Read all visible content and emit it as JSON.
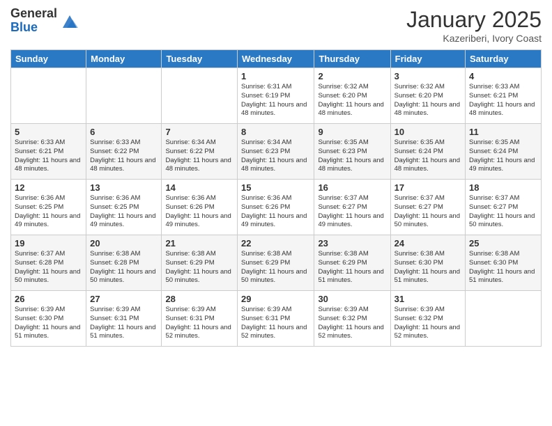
{
  "logo": {
    "general": "General",
    "blue": "Blue"
  },
  "header": {
    "month": "January 2025",
    "location": "Kazeriberi, Ivory Coast"
  },
  "weekdays": [
    "Sunday",
    "Monday",
    "Tuesday",
    "Wednesday",
    "Thursday",
    "Friday",
    "Saturday"
  ],
  "weeks": [
    [
      {
        "day": "",
        "sunrise": "",
        "sunset": "",
        "daylight": ""
      },
      {
        "day": "",
        "sunrise": "",
        "sunset": "",
        "daylight": ""
      },
      {
        "day": "",
        "sunrise": "",
        "sunset": "",
        "daylight": ""
      },
      {
        "day": "1",
        "sunrise": "Sunrise: 6:31 AM",
        "sunset": "Sunset: 6:19 PM",
        "daylight": "Daylight: 11 hours and 48 minutes."
      },
      {
        "day": "2",
        "sunrise": "Sunrise: 6:32 AM",
        "sunset": "Sunset: 6:20 PM",
        "daylight": "Daylight: 11 hours and 48 minutes."
      },
      {
        "day": "3",
        "sunrise": "Sunrise: 6:32 AM",
        "sunset": "Sunset: 6:20 PM",
        "daylight": "Daylight: 11 hours and 48 minutes."
      },
      {
        "day": "4",
        "sunrise": "Sunrise: 6:33 AM",
        "sunset": "Sunset: 6:21 PM",
        "daylight": "Daylight: 11 hours and 48 minutes."
      }
    ],
    [
      {
        "day": "5",
        "sunrise": "Sunrise: 6:33 AM",
        "sunset": "Sunset: 6:21 PM",
        "daylight": "Daylight: 11 hours and 48 minutes."
      },
      {
        "day": "6",
        "sunrise": "Sunrise: 6:33 AM",
        "sunset": "Sunset: 6:22 PM",
        "daylight": "Daylight: 11 hours and 48 minutes."
      },
      {
        "day": "7",
        "sunrise": "Sunrise: 6:34 AM",
        "sunset": "Sunset: 6:22 PM",
        "daylight": "Daylight: 11 hours and 48 minutes."
      },
      {
        "day": "8",
        "sunrise": "Sunrise: 6:34 AM",
        "sunset": "Sunset: 6:23 PM",
        "daylight": "Daylight: 11 hours and 48 minutes."
      },
      {
        "day": "9",
        "sunrise": "Sunrise: 6:35 AM",
        "sunset": "Sunset: 6:23 PM",
        "daylight": "Daylight: 11 hours and 48 minutes."
      },
      {
        "day": "10",
        "sunrise": "Sunrise: 6:35 AM",
        "sunset": "Sunset: 6:24 PM",
        "daylight": "Daylight: 11 hours and 48 minutes."
      },
      {
        "day": "11",
        "sunrise": "Sunrise: 6:35 AM",
        "sunset": "Sunset: 6:24 PM",
        "daylight": "Daylight: 11 hours and 49 minutes."
      }
    ],
    [
      {
        "day": "12",
        "sunrise": "Sunrise: 6:36 AM",
        "sunset": "Sunset: 6:25 PM",
        "daylight": "Daylight: 11 hours and 49 minutes."
      },
      {
        "day": "13",
        "sunrise": "Sunrise: 6:36 AM",
        "sunset": "Sunset: 6:25 PM",
        "daylight": "Daylight: 11 hours and 49 minutes."
      },
      {
        "day": "14",
        "sunrise": "Sunrise: 6:36 AM",
        "sunset": "Sunset: 6:26 PM",
        "daylight": "Daylight: 11 hours and 49 minutes."
      },
      {
        "day": "15",
        "sunrise": "Sunrise: 6:36 AM",
        "sunset": "Sunset: 6:26 PM",
        "daylight": "Daylight: 11 hours and 49 minutes."
      },
      {
        "day": "16",
        "sunrise": "Sunrise: 6:37 AM",
        "sunset": "Sunset: 6:27 PM",
        "daylight": "Daylight: 11 hours and 49 minutes."
      },
      {
        "day": "17",
        "sunrise": "Sunrise: 6:37 AM",
        "sunset": "Sunset: 6:27 PM",
        "daylight": "Daylight: 11 hours and 50 minutes."
      },
      {
        "day": "18",
        "sunrise": "Sunrise: 6:37 AM",
        "sunset": "Sunset: 6:27 PM",
        "daylight": "Daylight: 11 hours and 50 minutes."
      }
    ],
    [
      {
        "day": "19",
        "sunrise": "Sunrise: 6:37 AM",
        "sunset": "Sunset: 6:28 PM",
        "daylight": "Daylight: 11 hours and 50 minutes."
      },
      {
        "day": "20",
        "sunrise": "Sunrise: 6:38 AM",
        "sunset": "Sunset: 6:28 PM",
        "daylight": "Daylight: 11 hours and 50 minutes."
      },
      {
        "day": "21",
        "sunrise": "Sunrise: 6:38 AM",
        "sunset": "Sunset: 6:29 PM",
        "daylight": "Daylight: 11 hours and 50 minutes."
      },
      {
        "day": "22",
        "sunrise": "Sunrise: 6:38 AM",
        "sunset": "Sunset: 6:29 PM",
        "daylight": "Daylight: 11 hours and 50 minutes."
      },
      {
        "day": "23",
        "sunrise": "Sunrise: 6:38 AM",
        "sunset": "Sunset: 6:29 PM",
        "daylight": "Daylight: 11 hours and 51 minutes."
      },
      {
        "day": "24",
        "sunrise": "Sunrise: 6:38 AM",
        "sunset": "Sunset: 6:30 PM",
        "daylight": "Daylight: 11 hours and 51 minutes."
      },
      {
        "day": "25",
        "sunrise": "Sunrise: 6:38 AM",
        "sunset": "Sunset: 6:30 PM",
        "daylight": "Daylight: 11 hours and 51 minutes."
      }
    ],
    [
      {
        "day": "26",
        "sunrise": "Sunrise: 6:39 AM",
        "sunset": "Sunset: 6:30 PM",
        "daylight": "Daylight: 11 hours and 51 minutes."
      },
      {
        "day": "27",
        "sunrise": "Sunrise: 6:39 AM",
        "sunset": "Sunset: 6:31 PM",
        "daylight": "Daylight: 11 hours and 51 minutes."
      },
      {
        "day": "28",
        "sunrise": "Sunrise: 6:39 AM",
        "sunset": "Sunset: 6:31 PM",
        "daylight": "Daylight: 11 hours and 52 minutes."
      },
      {
        "day": "29",
        "sunrise": "Sunrise: 6:39 AM",
        "sunset": "Sunset: 6:31 PM",
        "daylight": "Daylight: 11 hours and 52 minutes."
      },
      {
        "day": "30",
        "sunrise": "Sunrise: 6:39 AM",
        "sunset": "Sunset: 6:32 PM",
        "daylight": "Daylight: 11 hours and 52 minutes."
      },
      {
        "day": "31",
        "sunrise": "Sunrise: 6:39 AM",
        "sunset": "Sunset: 6:32 PM",
        "daylight": "Daylight: 11 hours and 52 minutes."
      },
      {
        "day": "",
        "sunrise": "",
        "sunset": "",
        "daylight": ""
      }
    ]
  ]
}
